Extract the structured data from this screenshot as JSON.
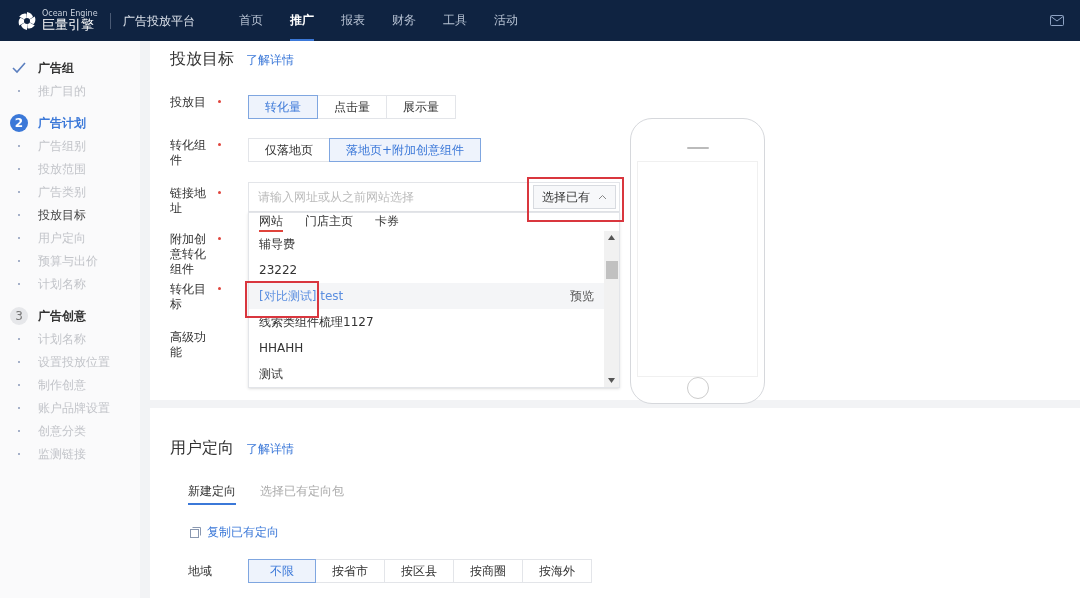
{
  "top_nav": {
    "brand_small": "Ocean Engine",
    "brand": "巨量引擎",
    "platform": "广告投放平台",
    "items": [
      {
        "label": "首页",
        "selected": false
      },
      {
        "label": "推广",
        "selected": true
      },
      {
        "label": "报表",
        "selected": false
      },
      {
        "label": "财务",
        "selected": false
      },
      {
        "label": "工具",
        "selected": false
      },
      {
        "label": "活动",
        "selected": false
      }
    ]
  },
  "sidebar": {
    "steps": [
      {
        "kind": "done",
        "label": "广告组",
        "children": [
          {
            "label": "推广目的",
            "selected": false
          }
        ]
      },
      {
        "kind": "current",
        "marker": "2",
        "label": "广告计划",
        "children": [
          {
            "label": "广告组别",
            "selected": false
          },
          {
            "label": "投放范围",
            "selected": false
          },
          {
            "label": "广告类别",
            "selected": false
          },
          {
            "label": "投放目标",
            "selected": true
          },
          {
            "label": "用户定向",
            "selected": false
          },
          {
            "label": "预算与出价",
            "selected": false
          },
          {
            "label": "计划名称",
            "selected": false
          }
        ]
      },
      {
        "kind": "pending",
        "marker": "3",
        "label": "广告创意",
        "children": [
          {
            "label": "计划名称",
            "selected": false
          },
          {
            "label": "设置投放位置",
            "selected": false
          },
          {
            "label": "制作创意",
            "selected": false
          },
          {
            "label": "账户品牌设置",
            "selected": false
          },
          {
            "label": "创意分类",
            "selected": false
          },
          {
            "label": "监测链接",
            "selected": false
          }
        ]
      }
    ]
  },
  "goal_section": {
    "title": "投放目标",
    "link": "了解详情",
    "fields": [
      {
        "kind": "segmented",
        "label": "投放目",
        "required": true,
        "options": [
          {
            "label": "转化量",
            "selected": true
          },
          {
            "label": "点击量",
            "selected": false
          },
          {
            "label": "展示量",
            "selected": false
          }
        ]
      },
      {
        "kind": "segmented",
        "label": "转化组件",
        "required": true,
        "options": [
          {
            "label": "仅落地页",
            "selected": false
          },
          {
            "label": "落地页+附加创意组件",
            "selected": true
          }
        ]
      },
      {
        "kind": "url",
        "label": "链接地址",
        "required": true,
        "placeholder": "请输入网址或从之前网站选择",
        "button": "选择已有",
        "expanded": true
      },
      {
        "kind": "blank",
        "label": "附加创意转化组件",
        "required": true
      },
      {
        "kind": "blank",
        "label": "转化目标",
        "required": true
      },
      {
        "kind": "blank",
        "label": "高级功能",
        "required": false
      }
    ],
    "dropdown": {
      "tabs": [
        {
          "label": "网站",
          "selected": true
        },
        {
          "label": "门店主页",
          "selected": false
        },
        {
          "label": "卡券",
          "selected": false
        }
      ],
      "items": [
        {
          "label": "辅导费",
          "highlighted": false
        },
        {
          "label": "23222",
          "highlighted": false
        },
        {
          "label": "[对比测试] test",
          "highlighted": true,
          "action": "预览"
        },
        {
          "label": "线索类组件梳理1127",
          "highlighted": false
        },
        {
          "label": "HHAHH",
          "highlighted": false
        },
        {
          "label": "测试",
          "highlighted": false
        }
      ]
    }
  },
  "targeting_section": {
    "title": "用户定向",
    "link": "了解详情",
    "tabs": [
      {
        "label": "新建定向",
        "selected": true
      },
      {
        "label": "选择已有定向包",
        "selected": false
      }
    ],
    "copy_link": "复制已有定向",
    "region": {
      "label": "地域",
      "options": [
        {
          "label": "不限",
          "selected": true
        },
        {
          "label": "按省市",
          "selected": false
        },
        {
          "label": "按区县",
          "selected": false
        },
        {
          "label": "按商圈",
          "selected": false
        },
        {
          "label": "按海外",
          "selected": false
        }
      ]
    }
  }
}
